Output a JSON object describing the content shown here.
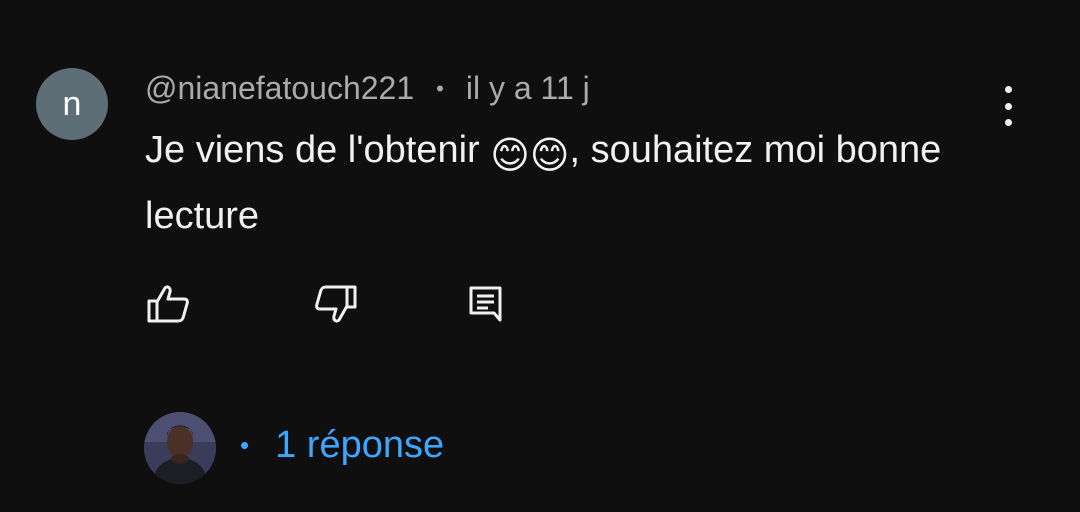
{
  "comment": {
    "avatar_letter": "n",
    "author": "@nianefatouch221",
    "separator": "•",
    "time": "il y a 11 j",
    "text_before": "Je viens de l'obtenir ",
    "emojis": "😊😊",
    "text_after": ",  souhaitez moi bonne lecture"
  },
  "actions": {
    "like_icon": "thumbs-up-icon",
    "dislike_icon": "thumbs-down-icon",
    "reply_icon": "comment-icon",
    "more_icon": "more-vertical-icon"
  },
  "replies": {
    "separator": "•",
    "label": "1 réponse"
  },
  "colors": {
    "background": "#0f0f0f",
    "text": "#f1f1f1",
    "muted": "#aaaaaa",
    "link": "#3ea6ff",
    "avatar": "#5d6e77"
  }
}
